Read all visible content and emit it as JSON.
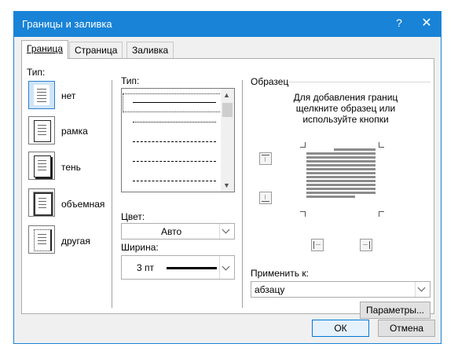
{
  "window": {
    "title": "Границы и заливка",
    "help": "?",
    "close": "✕"
  },
  "tabs": [
    {
      "label": "Граница",
      "active": true
    },
    {
      "label": "Страница",
      "active": false
    },
    {
      "label": "Заливка",
      "active": false
    }
  ],
  "settings": {
    "label": "Тип:",
    "items": [
      {
        "label": "нет",
        "selected": true,
        "icon": "none-border-icon"
      },
      {
        "label": "рамка",
        "selected": false,
        "icon": "box-border-icon"
      },
      {
        "label": "тень",
        "selected": false,
        "icon": "shadow-border-icon"
      },
      {
        "label": "объемная",
        "selected": false,
        "icon": "3d-border-icon"
      },
      {
        "label": "другая",
        "selected": false,
        "icon": "custom-border-icon"
      }
    ]
  },
  "style": {
    "label": "Тип:",
    "options": [
      "solid",
      "dotted",
      "dashed-fine",
      "dashed",
      "dash-dot"
    ],
    "selected_index": 0
  },
  "color": {
    "label": "Цвет:",
    "value": "Авто"
  },
  "width": {
    "label": "Ширина:",
    "value": "3 пт"
  },
  "preview": {
    "label": "Образец",
    "hint_line1": "Для добавления границ",
    "hint_line2": "щелкните образец или",
    "hint_line3": "используйте кнопки"
  },
  "apply_to": {
    "label": "Применить к:",
    "value": "абзацу"
  },
  "buttons": {
    "options": "Параметры...",
    "ok": "ОК",
    "cancel": "Отмена"
  },
  "colors": {
    "titlebar": "#1883d7",
    "accent": "#0078d7",
    "selected_bg": "#cfe4f8"
  }
}
